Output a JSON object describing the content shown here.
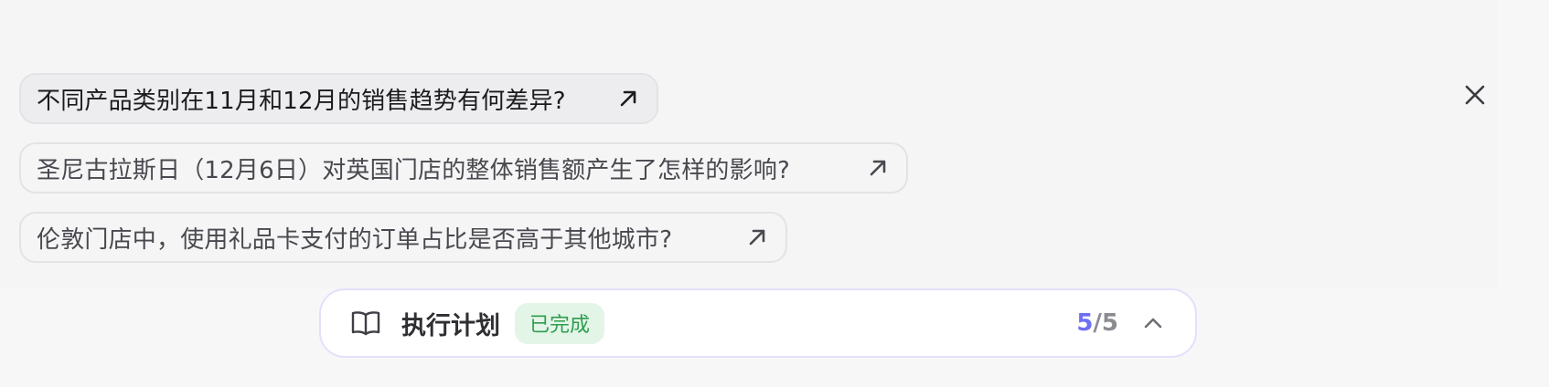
{
  "suggestions": [
    {
      "text": "不同产品类别在11月和12月的销售趋势有何差异?",
      "icon": "arrow-up-right-icon"
    },
    {
      "text": "圣尼古拉斯日（12月6日）对英国门店的整体销售额产生了怎样的影响?",
      "icon": "arrow-up-right-icon"
    },
    {
      "text": "伦敦门店中，使用礼品卡支付的订单占比是否高于其他城市?",
      "icon": "arrow-up-right-icon"
    }
  ],
  "close": {
    "icon": "close-icon"
  },
  "plan": {
    "icon": "book-open-icon",
    "title": "执行计划",
    "status": "已完成",
    "progress_current": "5",
    "progress_separator": "/",
    "progress_total": "5",
    "toggle_icon": "chevron-up-icon"
  },
  "colors": {
    "accent": "#6e6ef5",
    "status_bg": "#e3f5e7",
    "status_text": "#2e9d4f"
  }
}
